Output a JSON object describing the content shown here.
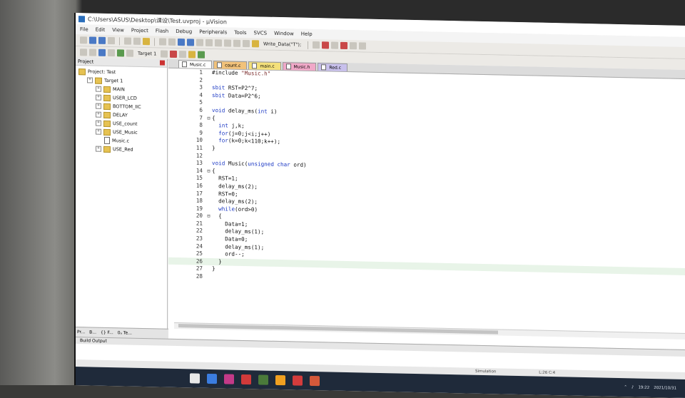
{
  "window": {
    "title": "C:\\Users\\ASUS\\Desktop\\课设\\Test.uvproj - µVision"
  },
  "menu": [
    "File",
    "Edit",
    "View",
    "Project",
    "Flash",
    "Debug",
    "Peripherals",
    "Tools",
    "SVCS",
    "Window",
    "Help"
  ],
  "toolbar": {
    "target": "Target 1",
    "search_value": "Write_Data(\"T\");"
  },
  "project_panel": {
    "title": "Project",
    "tree": [
      {
        "label": "Project: Test",
        "level": 0,
        "kind": "project"
      },
      {
        "label": "Target 1",
        "level": 1,
        "kind": "folder"
      },
      {
        "label": "MAIN",
        "level": 2,
        "kind": "folder"
      },
      {
        "label": "USER_LCD",
        "level": 2,
        "kind": "folder"
      },
      {
        "label": "BOTTOM_IIC",
        "level": 2,
        "kind": "folder"
      },
      {
        "label": "DELAY",
        "level": 2,
        "kind": "folder"
      },
      {
        "label": "USE_count",
        "level": 2,
        "kind": "folder"
      },
      {
        "label": "USE_Music",
        "level": 2,
        "kind": "folder"
      },
      {
        "label": "Music.c",
        "level": 3,
        "kind": "file"
      },
      {
        "label": "USE_Red",
        "level": 2,
        "kind": "folder"
      }
    ],
    "tabs": [
      "Pr...",
      "B...",
      "{} F...",
      "0ₐ Te..."
    ]
  },
  "editor": {
    "tabs": [
      {
        "label": "Music.c",
        "style": "active"
      },
      {
        "label": "count.c",
        "style": "orange"
      },
      {
        "label": "main.c",
        "style": "yellow2"
      },
      {
        "label": "Music.h",
        "style": "pink"
      },
      {
        "label": "Red.c",
        "style": "lilac"
      }
    ],
    "lines": [
      {
        "n": "1",
        "fold": "",
        "text": "#include \"Music.h\""
      },
      {
        "n": "2",
        "fold": "",
        "text": ""
      },
      {
        "n": "3",
        "fold": "",
        "text": "sbit RST=P2^7;"
      },
      {
        "n": "4",
        "fold": "",
        "text": "sbit Data=P2^6;"
      },
      {
        "n": "5",
        "fold": "",
        "text": ""
      },
      {
        "n": "6",
        "fold": "",
        "text": "void delay_ms(int i)"
      },
      {
        "n": "7",
        "fold": "⊟",
        "text": "{"
      },
      {
        "n": "8",
        "fold": "",
        "text": "  int j,k;"
      },
      {
        "n": "9",
        "fold": "",
        "text": "  for(j=0;j<i;j++)"
      },
      {
        "n": "10",
        "fold": "",
        "text": "  for(k=0;k<110;k++);"
      },
      {
        "n": "11",
        "fold": "",
        "text": "}"
      },
      {
        "n": "12",
        "fold": "",
        "text": ""
      },
      {
        "n": "13",
        "fold": "",
        "text": "void Music(unsigned char ord)"
      },
      {
        "n": "14",
        "fold": "⊟",
        "text": "{"
      },
      {
        "n": "15",
        "fold": "",
        "text": "  RST=1;"
      },
      {
        "n": "16",
        "fold": "",
        "text": "  delay_ms(2);"
      },
      {
        "n": "17",
        "fold": "",
        "text": "  RST=0;"
      },
      {
        "n": "18",
        "fold": "",
        "text": "  delay_ms(2);"
      },
      {
        "n": "19",
        "fold": "",
        "text": "  while(ord>0)"
      },
      {
        "n": "20",
        "fold": "⊟",
        "text": "  {"
      },
      {
        "n": "21",
        "fold": "",
        "text": "    Data=1;"
      },
      {
        "n": "22",
        "fold": "",
        "text": "    delay_ms(1);"
      },
      {
        "n": "23",
        "fold": "",
        "text": "    Data=0;"
      },
      {
        "n": "24",
        "fold": "",
        "text": "    delay_ms(1);"
      },
      {
        "n": "25",
        "fold": "",
        "text": "    ord--;"
      },
      {
        "n": "26",
        "fold": "",
        "text": "  }"
      },
      {
        "n": "27",
        "fold": "",
        "text": "}"
      },
      {
        "n": "28",
        "fold": "",
        "text": ""
      }
    ],
    "current_line": "26"
  },
  "build_output": {
    "title": "Build Output"
  },
  "statusbar": {
    "mode": "Simulation",
    "pos": "L:26 C:4"
  },
  "taskbar": {
    "time": "19:22",
    "date": "2021/10/31"
  },
  "colors": {
    "keyword": "#1b38c4",
    "tab_orange": "#f2c27a",
    "tab_yellow": "#f4e07a",
    "tab_pink": "#f0a8c8",
    "tab_lilac": "#c8c0ec"
  }
}
